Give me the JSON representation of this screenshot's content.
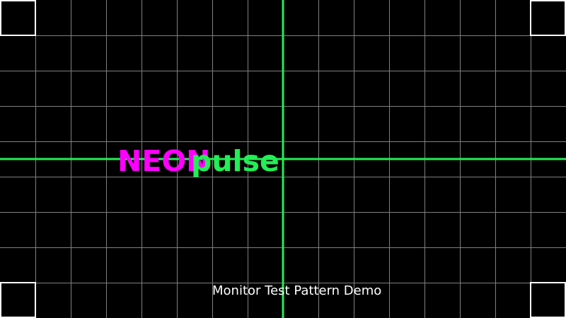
{
  "colors": {
    "background": "#000000",
    "grid_line": "#808080",
    "crosshair": "#22ee55",
    "corner_box": "#ffffff",
    "brand_primary": "#ff00ff",
    "brand_secondary": "#22ee55",
    "caption": "#ffffff"
  },
  "pattern": {
    "grid_columns": 16,
    "grid_rows": 9,
    "corner_marks": [
      "top-left",
      "top-right",
      "bottom-left",
      "bottom-right"
    ]
  },
  "brand": {
    "word_1": "NEON",
    "word_2": "pulse"
  },
  "caption": {
    "text": "Monitor Test Pattern Demo"
  }
}
